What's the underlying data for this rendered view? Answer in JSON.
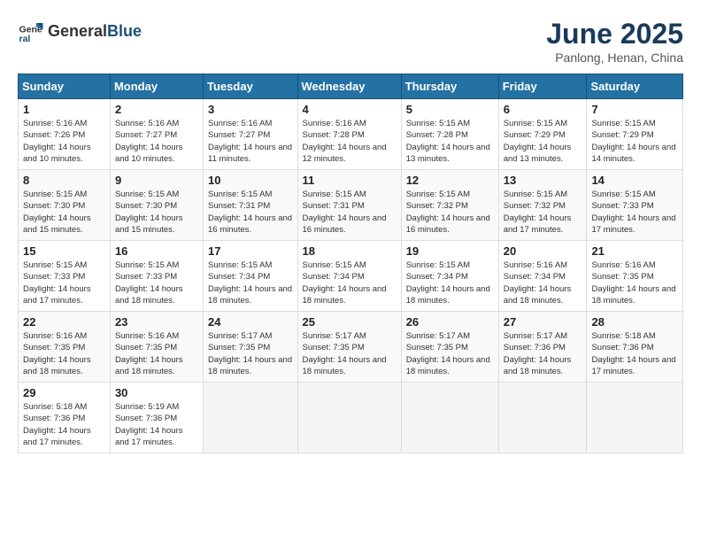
{
  "header": {
    "logo_general": "General",
    "logo_blue": "Blue",
    "title": "June 2025",
    "subtitle": "Panlong, Henan, China"
  },
  "calendar": {
    "days_of_week": [
      "Sunday",
      "Monday",
      "Tuesday",
      "Wednesday",
      "Thursday",
      "Friday",
      "Saturday"
    ],
    "weeks": [
      [
        null,
        null,
        null,
        null,
        {
          "day": 1,
          "sunrise": "5:16 AM",
          "sunset": "7:26 PM",
          "daylight": "14 hours and 10 minutes."
        },
        {
          "day": 2,
          "sunrise": "5:16 AM",
          "sunset": "7:27 PM",
          "daylight": "14 hours and 10 minutes."
        },
        {
          "day": 3,
          "sunrise": "5:16 AM",
          "sunset": "7:27 PM",
          "daylight": "14 hours and 11 minutes."
        },
        {
          "day": 4,
          "sunrise": "5:16 AM",
          "sunset": "7:28 PM",
          "daylight": "14 hours and 12 minutes."
        },
        {
          "day": 5,
          "sunrise": "5:15 AM",
          "sunset": "7:28 PM",
          "daylight": "14 hours and 13 minutes."
        },
        {
          "day": 6,
          "sunrise": "5:15 AM",
          "sunset": "7:29 PM",
          "daylight": "14 hours and 13 minutes."
        },
        {
          "day": 7,
          "sunrise": "5:15 AM",
          "sunset": "7:29 PM",
          "daylight": "14 hours and 14 minutes."
        }
      ],
      [
        {
          "day": 8,
          "sunrise": "5:15 AM",
          "sunset": "7:30 PM",
          "daylight": "14 hours and 15 minutes."
        },
        {
          "day": 9,
          "sunrise": "5:15 AM",
          "sunset": "7:30 PM",
          "daylight": "14 hours and 15 minutes."
        },
        {
          "day": 10,
          "sunrise": "5:15 AM",
          "sunset": "7:31 PM",
          "daylight": "14 hours and 16 minutes."
        },
        {
          "day": 11,
          "sunrise": "5:15 AM",
          "sunset": "7:31 PM",
          "daylight": "14 hours and 16 minutes."
        },
        {
          "day": 12,
          "sunrise": "5:15 AM",
          "sunset": "7:32 PM",
          "daylight": "14 hours and 16 minutes."
        },
        {
          "day": 13,
          "sunrise": "5:15 AM",
          "sunset": "7:32 PM",
          "daylight": "14 hours and 17 minutes."
        },
        {
          "day": 14,
          "sunrise": "5:15 AM",
          "sunset": "7:33 PM",
          "daylight": "14 hours and 17 minutes."
        }
      ],
      [
        {
          "day": 15,
          "sunrise": "5:15 AM",
          "sunset": "7:33 PM",
          "daylight": "14 hours and 17 minutes."
        },
        {
          "day": 16,
          "sunrise": "5:15 AM",
          "sunset": "7:33 PM",
          "daylight": "14 hours and 18 minutes."
        },
        {
          "day": 17,
          "sunrise": "5:15 AM",
          "sunset": "7:34 PM",
          "daylight": "14 hours and 18 minutes."
        },
        {
          "day": 18,
          "sunrise": "5:15 AM",
          "sunset": "7:34 PM",
          "daylight": "14 hours and 18 minutes."
        },
        {
          "day": 19,
          "sunrise": "5:15 AM",
          "sunset": "7:34 PM",
          "daylight": "14 hours and 18 minutes."
        },
        {
          "day": 20,
          "sunrise": "5:16 AM",
          "sunset": "7:34 PM",
          "daylight": "14 hours and 18 minutes."
        },
        {
          "day": 21,
          "sunrise": "5:16 AM",
          "sunset": "7:35 PM",
          "daylight": "14 hours and 18 minutes."
        }
      ],
      [
        {
          "day": 22,
          "sunrise": "5:16 AM",
          "sunset": "7:35 PM",
          "daylight": "14 hours and 18 minutes."
        },
        {
          "day": 23,
          "sunrise": "5:16 AM",
          "sunset": "7:35 PM",
          "daylight": "14 hours and 18 minutes."
        },
        {
          "day": 24,
          "sunrise": "5:17 AM",
          "sunset": "7:35 PM",
          "daylight": "14 hours and 18 minutes."
        },
        {
          "day": 25,
          "sunrise": "5:17 AM",
          "sunset": "7:35 PM",
          "daylight": "14 hours and 18 minutes."
        },
        {
          "day": 26,
          "sunrise": "5:17 AM",
          "sunset": "7:35 PM",
          "daylight": "14 hours and 18 minutes."
        },
        {
          "day": 27,
          "sunrise": "5:17 AM",
          "sunset": "7:36 PM",
          "daylight": "14 hours and 18 minutes."
        },
        {
          "day": 28,
          "sunrise": "5:18 AM",
          "sunset": "7:36 PM",
          "daylight": "14 hours and 17 minutes."
        }
      ],
      [
        {
          "day": 29,
          "sunrise": "5:18 AM",
          "sunset": "7:36 PM",
          "daylight": "14 hours and 17 minutes."
        },
        {
          "day": 30,
          "sunrise": "5:19 AM",
          "sunset": "7:36 PM",
          "daylight": "14 hours and 17 minutes."
        },
        null,
        null,
        null,
        null,
        null
      ]
    ]
  }
}
